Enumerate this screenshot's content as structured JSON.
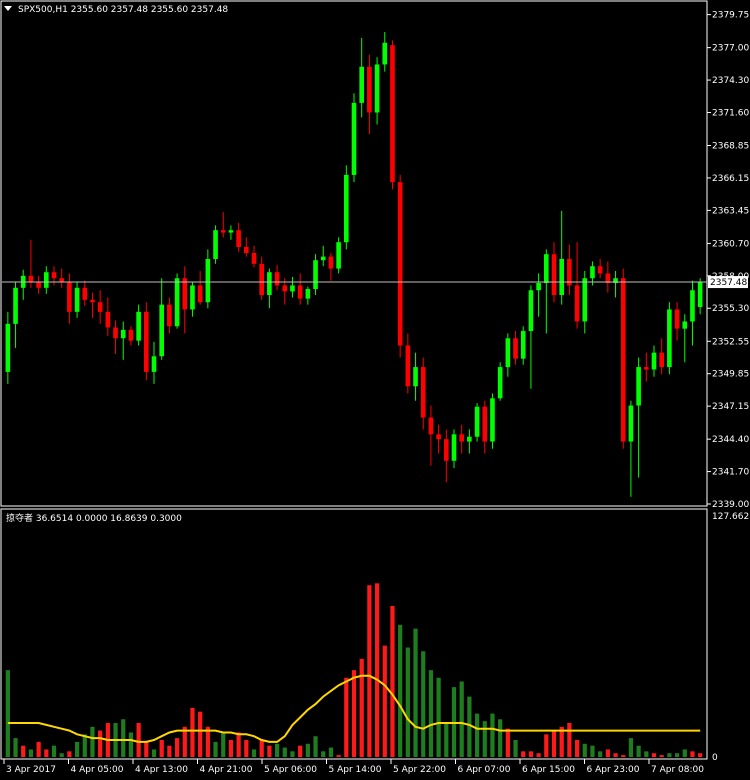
{
  "colors": {
    "background": "#000000",
    "frame": "#ffffff",
    "bull": "#00ff00",
    "bear": "#ff0000",
    "hist_up": "#1e7d1e",
    "hist_down": "#ff1a1a",
    "signal_line": "#ffd700",
    "price_line": "#c0c0c0",
    "price_box_bg": "#ffffff",
    "price_box_fg": "#000000"
  },
  "main_header": "SPX500,H1  2355.60 2357.48 2355.60 2357.48",
  "indicator_header": "掠夺者 36.6514 0.0000 16.8639 0.3000",
  "current_price": "2357.48",
  "chart_data": [
    {
      "type": "candlestick",
      "symbol": "SPX500",
      "timeframe": "H1",
      "ylim": [
        2339.0,
        2380.3
      ],
      "y_ticks": [
        "2379.75",
        "2377.00",
        "2374.30",
        "2371.60",
        "2368.85",
        "2366.15",
        "2363.45",
        "2360.70",
        "2358.00",
        "2355.30",
        "2352.55",
        "2349.85",
        "2347.15",
        "2344.40",
        "2341.70",
        "2339.00"
      ],
      "x_ticks": [
        "3 Apr 2017",
        "4 Apr 05:00",
        "4 Apr 13:00",
        "4 Apr 21:00",
        "5 Apr 06:00",
        "5 Apr 14:00",
        "5 Apr 22:00",
        "6 Apr 07:00",
        "6 Apr 15:00",
        "6 Apr 23:00",
        "7 Apr 08:00"
      ],
      "last_price": 2357.48,
      "candles": [
        [
          2350,
          2355,
          2349,
          2354
        ],
        [
          2354,
          2357.5,
          2352,
          2357
        ],
        [
          2357,
          2358.5,
          2356,
          2358
        ],
        [
          2358,
          2361,
          2357,
          2357.5
        ],
        [
          2357.5,
          2358,
          2356.5,
          2357
        ],
        [
          2357,
          2358.8,
          2356.5,
          2358.3
        ],
        [
          2358.3,
          2358.8,
          2357.2,
          2357.8
        ],
        [
          2357.8,
          2358.6,
          2357,
          2357.5
        ],
        [
          2357.5,
          2358.2,
          2354,
          2355
        ],
        [
          2355,
          2357.5,
          2354.5,
          2357
        ],
        [
          2357,
          2357.6,
          2355.5,
          2356
        ],
        [
          2356,
          2356.6,
          2354.5,
          2355.8
        ],
        [
          2355.8,
          2356.8,
          2354,
          2355
        ],
        [
          2355,
          2356.2,
          2353,
          2353.7
        ],
        [
          2353.7,
          2354.3,
          2351.5,
          2352.8
        ],
        [
          2352.8,
          2354.2,
          2351,
          2353.5
        ],
        [
          2353.5,
          2353.8,
          2352.2,
          2352.6
        ],
        [
          2352.6,
          2355.6,
          2352.2,
          2355
        ],
        [
          2355,
          2355.8,
          2349.3,
          2350
        ],
        [
          2350,
          2352.5,
          2349,
          2351.3
        ],
        [
          2351.3,
          2357.8,
          2351,
          2355.6
        ],
        [
          2355.6,
          2356.2,
          2353.2,
          2353.8
        ],
        [
          2353.8,
          2358.2,
          2353.6,
          2357.8
        ],
        [
          2357.8,
          2358.8,
          2353.2,
          2355.2
        ],
        [
          2355.2,
          2357.5,
          2354.6,
          2357.2
        ],
        [
          2357.2,
          2358.4,
          2355.6,
          2355.8
        ],
        [
          2355.8,
          2360.2,
          2355.3,
          2359.4
        ],
        [
          2359.4,
          2362.2,
          2359,
          2361.8
        ],
        [
          2361.8,
          2363.3,
          2361.2,
          2361.6
        ],
        [
          2361.6,
          2362.2,
          2361,
          2361.8
        ],
        [
          2361.8,
          2362.4,
          2360,
          2360.4
        ],
        [
          2360.4,
          2361.2,
          2359.6,
          2359.9
        ],
        [
          2359.9,
          2360.5,
          2358.7,
          2359
        ],
        [
          2359,
          2359.6,
          2356,
          2356.4
        ],
        [
          2356.4,
          2358.6,
          2355.3,
          2358.3
        ],
        [
          2358.3,
          2358.9,
          2356.8,
          2357.2
        ],
        [
          2357.2,
          2357.8,
          2355.6,
          2356.7
        ],
        [
          2356.7,
          2357.9,
          2356.2,
          2357.2
        ],
        [
          2357.2,
          2358.2,
          2355.6,
          2356.1
        ],
        [
          2356.1,
          2357.1,
          2355.6,
          2356.9
        ],
        [
          2356.9,
          2359.8,
          2356.4,
          2359.3
        ],
        [
          2359.3,
          2360.5,
          2358.8,
          2359.6
        ],
        [
          2359.6,
          2359.9,
          2357.6,
          2358.6
        ],
        [
          2358.6,
          2361.2,
          2358.2,
          2360.8
        ],
        [
          2360.8,
          2367.2,
          2360.2,
          2366.4
        ],
        [
          2366.4,
          2373.2,
          2365.8,
          2372.4
        ],
        [
          2372.4,
          2377.8,
          2371.2,
          2375.4
        ],
        [
          2375.4,
          2376.4,
          2369.8,
          2371.6
        ],
        [
          2371.6,
          2376.2,
          2370.6,
          2375.6
        ],
        [
          2375.6,
          2378.3,
          2375,
          2377.4
        ],
        [
          2377.2,
          2377.6,
          2365.2,
          2365.8
        ],
        [
          2365.8,
          2366.4,
          2351.2,
          2352.2
        ],
        [
          2352.2,
          2353.2,
          2348.2,
          2348.8
        ],
        [
          2348.8,
          2351.6,
          2347.6,
          2350.4
        ],
        [
          2350.4,
          2351.2,
          2345.2,
          2346.2
        ],
        [
          2346.2,
          2347.2,
          2342.2,
          2344.8
        ],
        [
          2344.8,
          2345.6,
          2343.2,
          2344.4
        ],
        [
          2344.4,
          2345.2,
          2340.8,
          2342.6
        ],
        [
          2342.6,
          2345.2,
          2342,
          2344.8
        ],
        [
          2344.8,
          2345.6,
          2343.2,
          2344.2
        ],
        [
          2344.2,
          2345.2,
          2343.2,
          2344.6
        ],
        [
          2344.6,
          2347.4,
          2344.2,
          2347.1
        ],
        [
          2347.1,
          2347.6,
          2343.2,
          2344.2
        ],
        [
          2344.2,
          2348.2,
          2343.6,
          2347.8
        ],
        [
          2347.8,
          2350.8,
          2347.6,
          2350.4
        ],
        [
          2350.4,
          2353.2,
          2349.6,
          2352.8
        ],
        [
          2352.8,
          2353.4,
          2350.6,
          2351.1
        ],
        [
          2351.1,
          2353.8,
          2350.6,
          2353.4
        ],
        [
          2353.4,
          2357.2,
          2348.6,
          2356.8
        ],
        [
          2356.8,
          2358.2,
          2354.6,
          2357.4
        ],
        [
          2357.4,
          2360.2,
          2353.2,
          2359.8
        ],
        [
          2359.8,
          2360.8,
          2355.8,
          2356.4
        ],
        [
          2356.4,
          2363.4,
          2355.6,
          2359.4
        ],
        [
          2359.4,
          2360.6,
          2356.4,
          2357.2
        ],
        [
          2357.2,
          2360.8,
          2353.6,
          2354.2
        ],
        [
          2354.2,
          2358.4,
          2353.2,
          2357.8
        ],
        [
          2357.8,
          2359.2,
          2357.2,
          2358.8
        ],
        [
          2358.8,
          2359.4,
          2357.8,
          2358.2
        ],
        [
          2358.2,
          2359.2,
          2356.6,
          2357.4
        ],
        [
          2357.4,
          2358.4,
          2356.2,
          2357.8
        ],
        [
          2357.8,
          2358.6,
          2343.6,
          2344.2
        ],
        [
          2344.2,
          2347.6,
          2339.6,
          2347.2
        ],
        [
          2347.2,
          2351.2,
          2341.2,
          2350.4
        ],
        [
          2350.4,
          2351.6,
          2349.2,
          2350.2
        ],
        [
          2350.2,
          2352.2,
          2349.6,
          2351.6
        ],
        [
          2351.6,
          2352.8,
          2349.8,
          2350.4
        ],
        [
          2350.4,
          2355.8,
          2349.8,
          2355.2
        ],
        [
          2355.2,
          2355.8,
          2352.6,
          2353.6
        ],
        [
          2353.6,
          2354.8,
          2350.8,
          2354.2
        ],
        [
          2354.2,
          2357.6,
          2352.2,
          2356.8
        ],
        [
          2355.4,
          2357.8,
          2354.8,
          2357.48
        ]
      ]
    },
    {
      "type": "histogram",
      "ylim": [
        0,
        127.6628
      ],
      "y_ticks": [
        "127.6628",
        "0"
      ],
      "series": [
        {
          "values": [
            46,
            10,
            6,
            4,
            8,
            4,
            6,
            2,
            3,
            8,
            12,
            16,
            14,
            18,
            18,
            20,
            13,
            18,
            8,
            4,
            9,
            6,
            10,
            16,
            26,
            24,
            16,
            8,
            13,
            9,
            13,
            9,
            4,
            9,
            6,
            7,
            5,
            3,
            6,
            7,
            11,
            3,
            5,
            1,
            42,
            46,
            52,
            91,
            92,
            59,
            80,
            70,
            58,
            68,
            56,
            46,
            42,
            18,
            37,
            40,
            32,
            23,
            19,
            23,
            20,
            15,
            9,
            3,
            3,
            2,
            12,
            14,
            16,
            18,
            9,
            7,
            6,
            3,
            4,
            2,
            1,
            10,
            6,
            3,
            2,
            1,
            2,
            2,
            4,
            3,
            2
          ],
          "colors": [
            "g",
            "g",
            "r",
            "g",
            "r",
            "r",
            "g",
            "g",
            "r",
            "g",
            "g",
            "g",
            "r",
            "r",
            "g",
            "g",
            "g",
            "r",
            "r",
            "g",
            "r",
            "r",
            "r",
            "r",
            "r",
            "r",
            "r",
            "g",
            "g",
            "r",
            "r",
            "r",
            "g",
            "r",
            "r",
            "g",
            "g",
            "g",
            "r",
            "g",
            "g",
            "g",
            "g",
            "r",
            "r",
            "r",
            "r",
            "r",
            "r",
            "r",
            "r",
            "g",
            "g",
            "g",
            "g",
            "g",
            "g",
            "g",
            "g",
            "g",
            "g",
            "g",
            "g",
            "g",
            "g",
            "r",
            "g",
            "r",
            "r",
            "r",
            "r",
            "r",
            "r",
            "r",
            "r",
            "g",
            "g",
            "g",
            "r",
            "r",
            "r",
            "g",
            "g",
            "g",
            "r",
            "r",
            "g",
            "g",
            "g",
            "r",
            "r"
          ]
        },
        {
          "type": "line",
          "values": [
            18,
            18,
            18,
            18,
            18,
            17,
            16,
            15,
            14,
            12,
            11,
            10,
            10,
            9,
            9,
            9,
            9,
            8,
            8,
            9,
            11,
            13,
            14,
            14,
            14,
            14,
            14,
            14,
            13,
            13,
            12,
            12,
            11,
            9,
            8,
            8,
            11,
            17,
            21,
            25,
            28,
            32,
            35,
            38,
            40,
            42,
            43,
            43,
            41,
            38,
            33,
            27,
            20,
            16,
            15,
            17,
            18,
            18,
            18,
            18,
            17,
            15,
            15,
            15,
            14,
            14,
            14,
            14,
            14,
            14,
            14,
            14,
            14,
            14,
            14,
            14,
            14,
            14,
            14,
            14,
            14,
            14,
            14,
            14,
            14,
            14,
            14,
            14,
            14,
            14,
            14
          ]
        }
      ]
    }
  ]
}
